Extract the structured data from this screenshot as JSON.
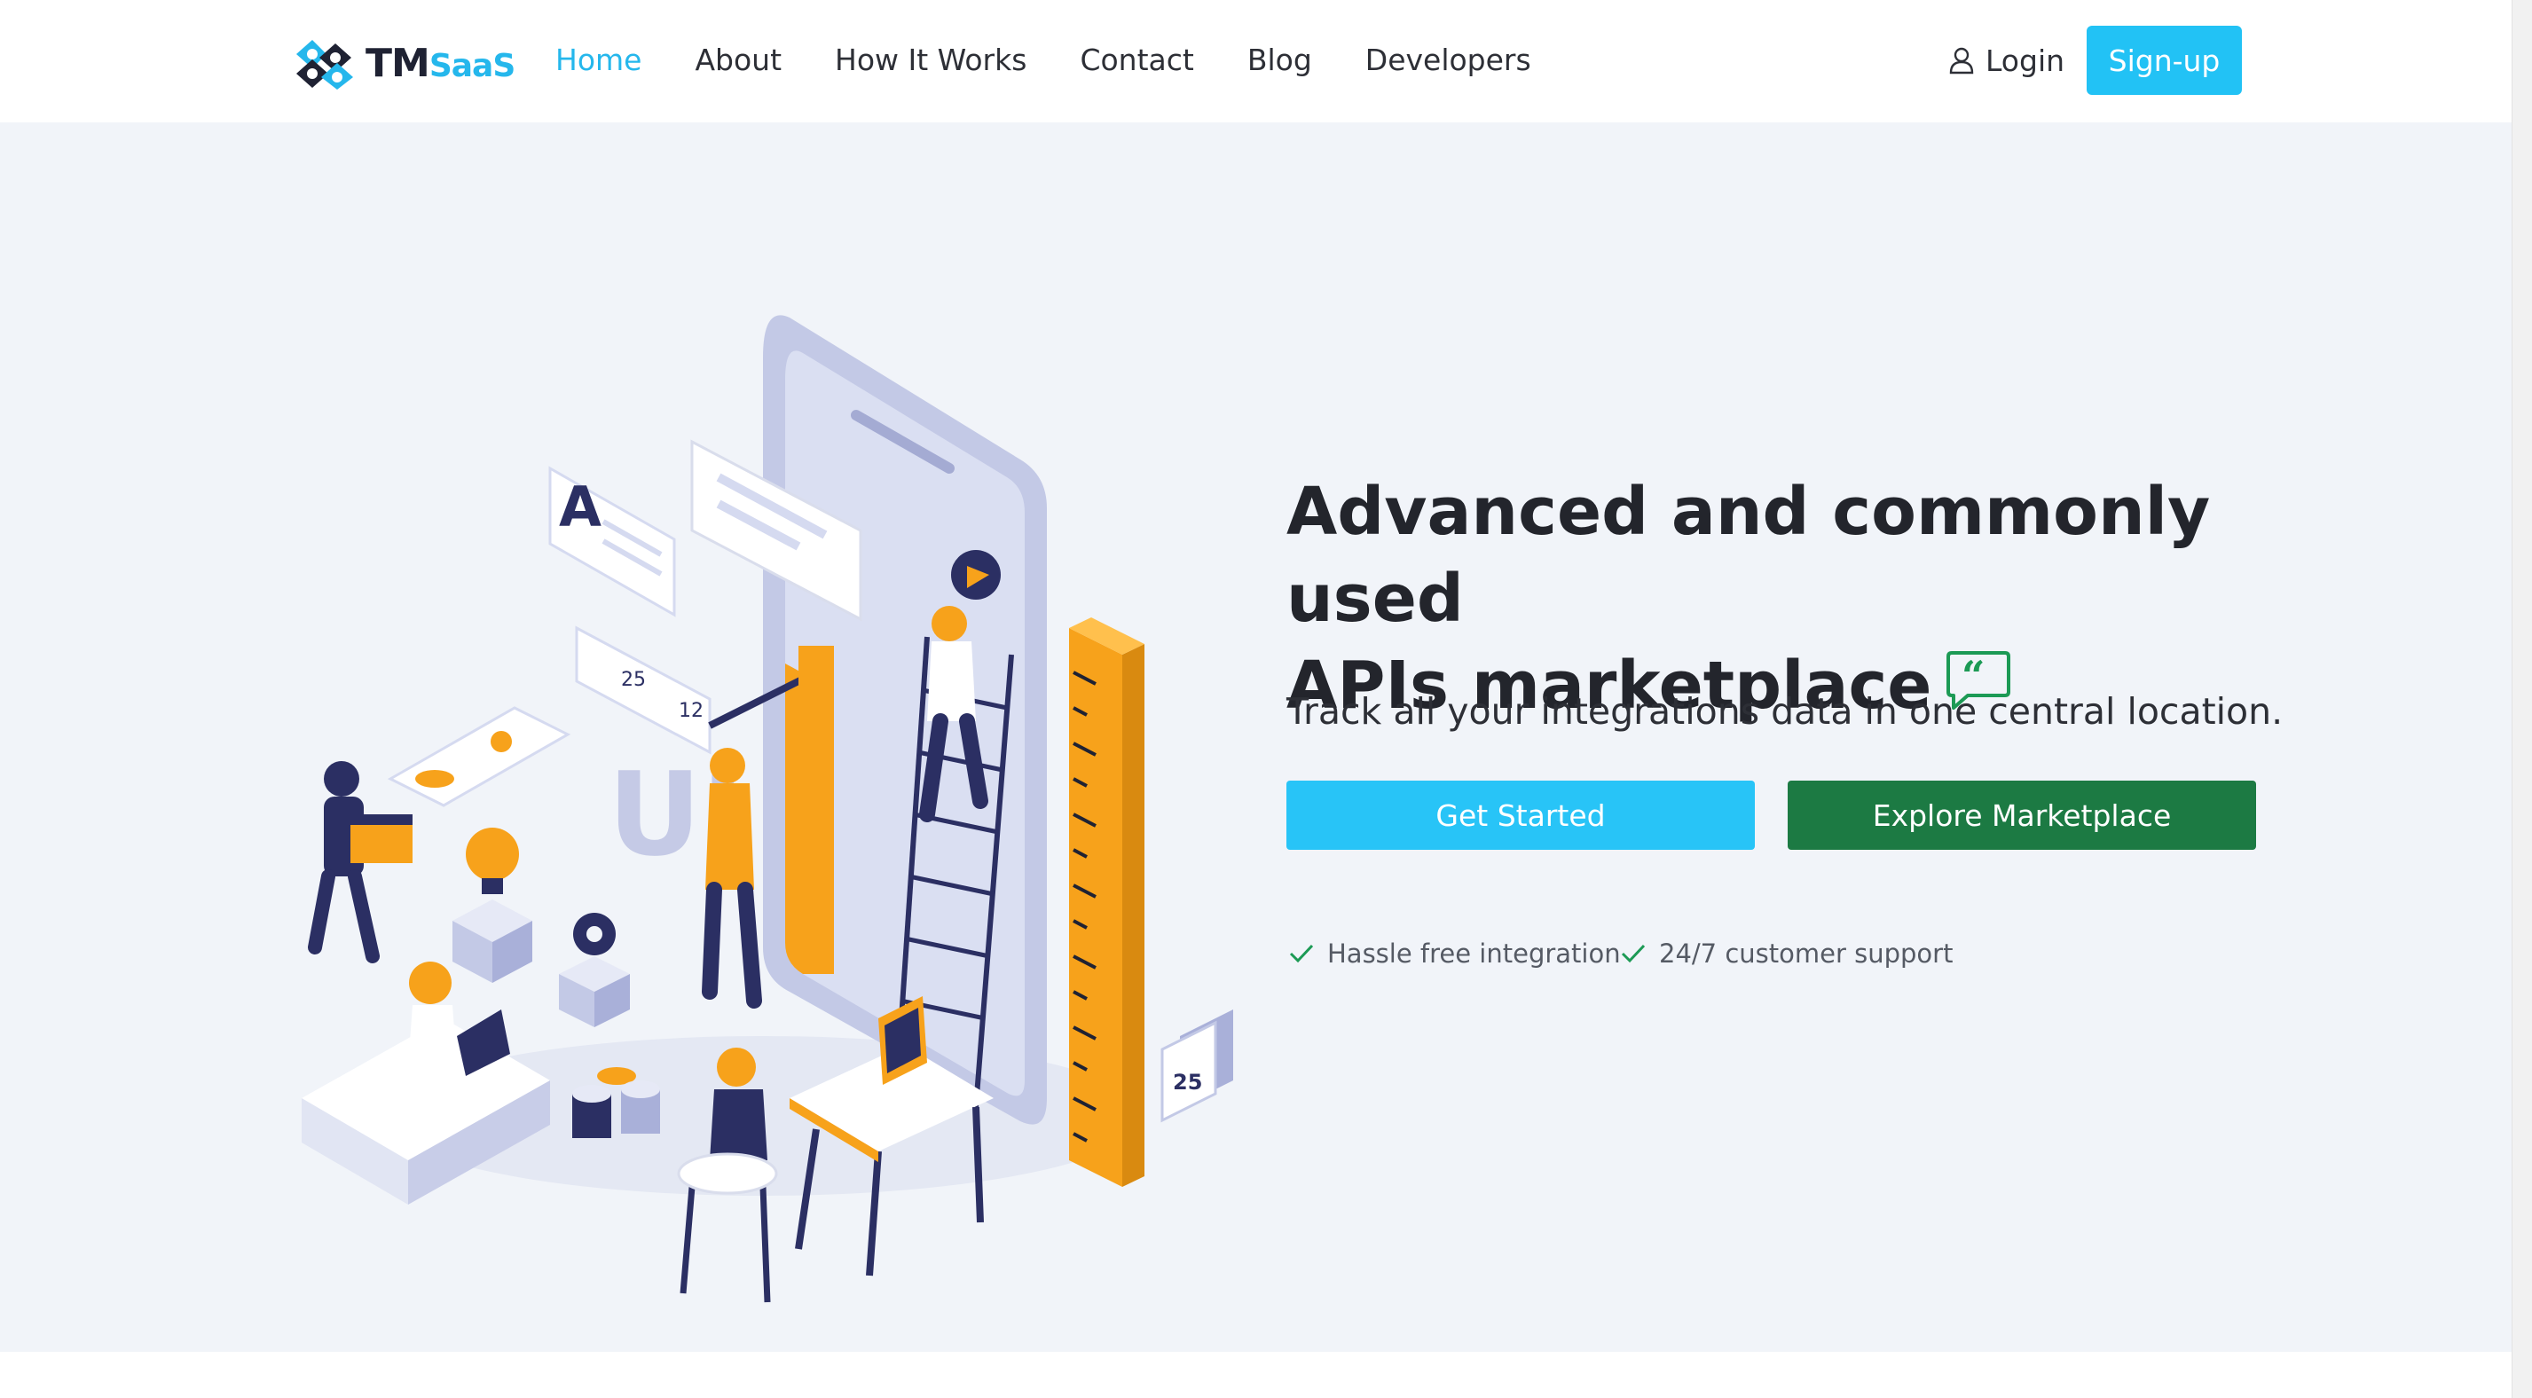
{
  "brand": {
    "logo_main": "TM",
    "logo_sub": "SaaS"
  },
  "nav": {
    "items": [
      {
        "label": "Home",
        "active": true
      },
      {
        "label": "About"
      },
      {
        "label": "How It Works"
      },
      {
        "label": "Contact"
      },
      {
        "label": "Blog"
      },
      {
        "label": "Developers"
      }
    ],
    "login_label": "Login",
    "signup_label": "Sign-up"
  },
  "hero": {
    "headline_line1": "Advanced and commonly used",
    "headline_line2": "APIs marketplace",
    "subline": "Track all your integrations data in one central location.",
    "primary_button": "Get Started",
    "secondary_button": "Explore Marketplace",
    "features": [
      "Hassle free integration",
      "24/7 customer support"
    ]
  },
  "illustration": {
    "ui_letters": "UI",
    "letter_a": "A",
    "heart_count_1": "25",
    "heart_count_2": "12",
    "calendar_day": "25"
  },
  "colors": {
    "accent": "#25b7ec",
    "primary_button": "#28c4f7",
    "secondary_button": "#1c7a43",
    "check": "#1c9a55",
    "hero_bg": "#f1f4f9"
  },
  "icons": [
    "tmsaas-logo-icon",
    "user-icon",
    "quote-bubble-icon",
    "check-icon"
  ]
}
